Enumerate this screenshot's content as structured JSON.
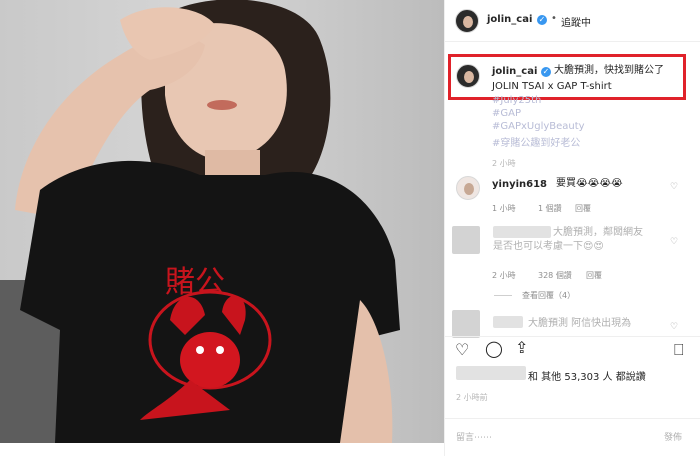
{
  "header": {
    "username": "jolin_cai",
    "dot": "•",
    "follow_status": "追蹤中",
    "verified_mark": "✓",
    "more": "..."
  },
  "caption": {
    "username": "jolin_cai",
    "text": "大膽預測，快找到賭公了",
    "line2": "JOLIN TSAI x GAP T-shirt",
    "hashtags": [
      "#July25th",
      "#GAP",
      "#GAPxUglyBeauty",
      "#穿賭公趣到好老公"
    ],
    "time": "2 小時"
  },
  "comments": [
    {
      "username": "yinyin618",
      "text": "要買😭😭😭😭",
      "time": "1 小時",
      "likes": "1 個讚",
      "reply": "回覆"
    },
    {
      "text_line1": "大膽預測，鄰闆網友",
      "text_line2": "是否也可以考慮一下😍😍",
      "time": "2 小時",
      "likes": "328 個讚",
      "reply": "回覆",
      "view_replies": "查看回覆（4）"
    },
    {
      "text": "大膽預測 阿信快出現為"
    }
  ],
  "actions": {
    "like_icon": "heart-icon",
    "comment_icon": "comment-icon",
    "share_icon": "share-icon",
    "save_icon": "bookmark-icon"
  },
  "likes": {
    "text": "和 其他 53,303 人 都說讚",
    "time": "2 小時前"
  },
  "comment_input": {
    "placeholder": "留言⋯⋯",
    "post": "發佈"
  },
  "shirt": {
    "print_text": "賭公"
  }
}
